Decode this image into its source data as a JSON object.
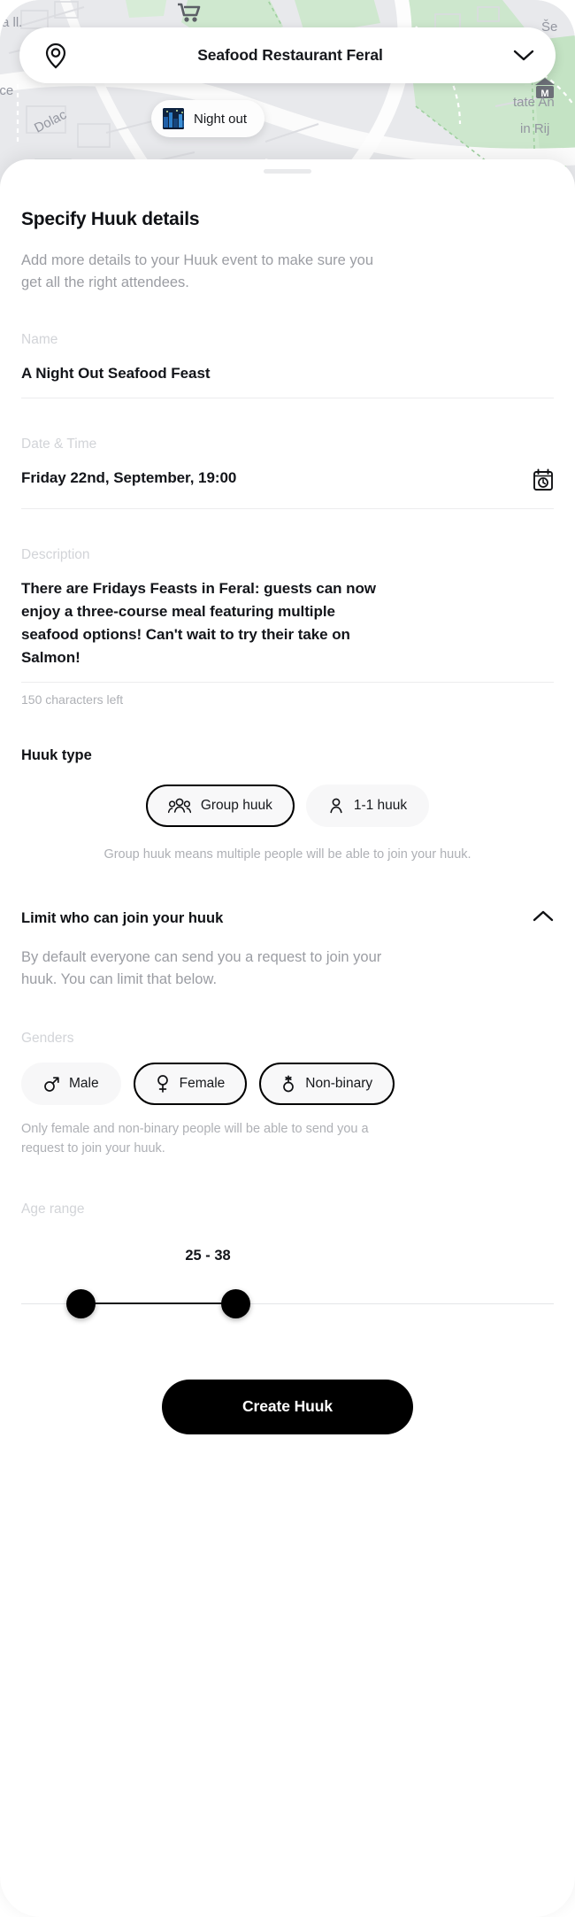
{
  "location_bar": {
    "pin_icon": "map-pin-icon",
    "value": "Seafood Restaurant Feral",
    "chevron_icon": "chevron-down-icon"
  },
  "category_chip": {
    "icon": "night-city-thumbnail",
    "label": "Night out"
  },
  "sheet": {
    "title": "Specify Huuk details",
    "subtitle": "Add more details to your Huuk event to make sure you get all the right attendees."
  },
  "fields": {
    "name": {
      "label": "Name",
      "value": "A Night Out Seafood Feast"
    },
    "datetime": {
      "label": "Date & Time",
      "value": "Friday 22nd, September, 19:00",
      "icon": "calendar-clock-icon"
    },
    "description": {
      "label": "Description",
      "value": "There are Fridays Feasts in Feral: guests can now enjoy a three-course meal featuring multiple seafood options! Can't wait to try their take on Salmon!",
      "counter": "150 characters left"
    }
  },
  "huuk_type": {
    "heading": "Huuk type",
    "options": [
      {
        "label": "Group huuk",
        "icon": "group-people-icon",
        "selected": true
      },
      {
        "label": "1-1 huuk",
        "icon": "single-person-icon",
        "selected": false
      }
    ],
    "note": "Group huuk means multiple people will be able to join your huuk."
  },
  "limit_section": {
    "title": "Limit who can join your huuk",
    "toggle_icon": "chevron-up-icon",
    "description": "By default everyone can send you a request to join your huuk. You can limit that below."
  },
  "genders": {
    "label": "Genders",
    "options": [
      {
        "label": "Male",
        "icon": "mars-symbol-icon",
        "selected": false
      },
      {
        "label": "Female",
        "icon": "venus-symbol-icon",
        "selected": true
      },
      {
        "label": "Non-binary",
        "icon": "non-binary-symbol-icon",
        "selected": true
      }
    ],
    "note": "Only female and non-binary people will be able to send you a request to join your huuk."
  },
  "age_range": {
    "label": "Age range",
    "value": "25 - 38",
    "min": 25,
    "max": 38
  },
  "cta": {
    "label": "Create Huuk"
  },
  "colors": {
    "accent": "#000000",
    "muted": "#aeb0b5",
    "placeholder": "#d2d4d8",
    "map_land": "#e8e9ec",
    "map_green": "#c8e6c9"
  }
}
